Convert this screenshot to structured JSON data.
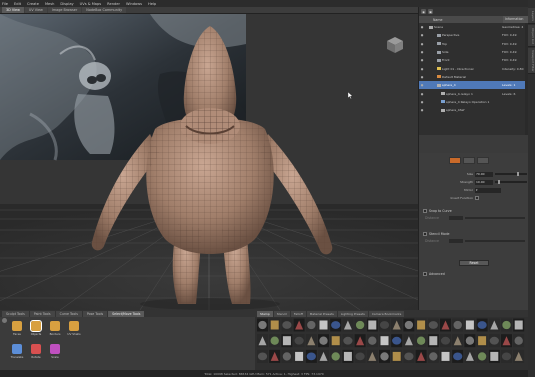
{
  "menubar": [
    "File",
    "Edit",
    "Create",
    "Mesh",
    "Display",
    "UVs & Maps",
    "Render",
    "Windows",
    "Help"
  ],
  "view_tabs": [
    {
      "label": "3D View",
      "active": true
    },
    {
      "label": "UV View",
      "active": false
    },
    {
      "label": "Image Browser",
      "active": false
    },
    {
      "label": "NodeBox Community",
      "active": false
    }
  ],
  "right_side_tabs": [
    "Layers",
    "Object List",
    "Viewport Filter"
  ],
  "scene": {
    "header_name": "Name",
    "header_value": "Information",
    "rows": [
      {
        "name": "Scene",
        "value": "Geometries: 4",
        "indent": 0,
        "glyph": "scene",
        "selected": false
      },
      {
        "name": "Perspective",
        "value": "FOV: 0.49",
        "indent": 2,
        "glyph": "camera",
        "selected": false
      },
      {
        "name": "Top",
        "value": "FOV: 0.49",
        "indent": 2,
        "glyph": "camera",
        "selected": false
      },
      {
        "name": "Side",
        "value": "FOV: 0.49",
        "indent": 2,
        "glyph": "camera",
        "selected": false
      },
      {
        "name": "Front",
        "value": "FOV: 0.49",
        "indent": 2,
        "glyph": "camera",
        "selected": false
      },
      {
        "name": "Light 01 - Directional",
        "value": "Intensity: 0.80",
        "indent": 2,
        "glyph": "light",
        "selected": false
      },
      {
        "name": "Default Material",
        "value": "",
        "indent": 2,
        "glyph": "material",
        "selected": false
      },
      {
        "name": "sphere_4",
        "value": "Levels: 1",
        "indent": 2,
        "glyph": "mesh",
        "selected": true
      },
      {
        "name": "sphere_4-relayo 1",
        "value": "Levels: 6",
        "indent": 3,
        "glyph": "mesh",
        "selected": false
      },
      {
        "name": "sphere_4 Relayo Operation 1",
        "value": "",
        "indent": 3,
        "glyph": "op",
        "selected": false
      },
      {
        "name": "sphere_43ef",
        "value": "",
        "indent": 3,
        "glyph": "mesh",
        "selected": false
      }
    ]
  },
  "properties": {
    "size_label": "Size",
    "size_value": "70.00",
    "size_pos": 0.7,
    "strength_label": "Strength",
    "strength_value": "10.00",
    "strength_pos": 0.1,
    "mirror_label": "Mirror",
    "invert_label": "Invert Function",
    "snap_label": "Snap to Curve",
    "snap_sub": "Distance",
    "stencil_label": "Stencil Mode",
    "stencil_sub": "Distance",
    "reset_label": "Reset",
    "advanced_label": "Advanced"
  },
  "bottom_tabs": [
    {
      "label": "Sculpt Tools",
      "active": false
    },
    {
      "label": "Paint Tools",
      "active": false
    },
    {
      "label": "Curve Tools",
      "active": false
    },
    {
      "label": "Pose Tools",
      "active": false
    },
    {
      "label": "Select/Move Tools",
      "active": true
    }
  ],
  "tools": [
    {
      "label": "Faces",
      "color": "#d8a040"
    },
    {
      "label": "Objects",
      "color": "#d8a040"
    },
    {
      "label": "Borders",
      "color": "#d8a040"
    },
    {
      "label": "UV Shells",
      "color": "#d8a040"
    },
    {
      "label": "Translate",
      "color": "#5c8ed8"
    },
    {
      "label": "Rotate",
      "color": "#d85050"
    },
    {
      "label": "Scale",
      "color": "#c050c0"
    }
  ],
  "stamp_tabs": [
    {
      "label": "Stamp",
      "active": true
    },
    {
      "label": "Stencil",
      "active": false
    },
    {
      "label": "Falloff",
      "active": false
    },
    {
      "label": "Material Presets",
      "active": false
    },
    {
      "label": "Lighting Presets",
      "active": false
    },
    {
      "label": "Camera Bookmarks",
      "active": false
    }
  ],
  "status": "Total: 10098  Selected: 86534  GPU Mem: 571  Active: 1, Highest: 3  FPS: 73.1970"
}
